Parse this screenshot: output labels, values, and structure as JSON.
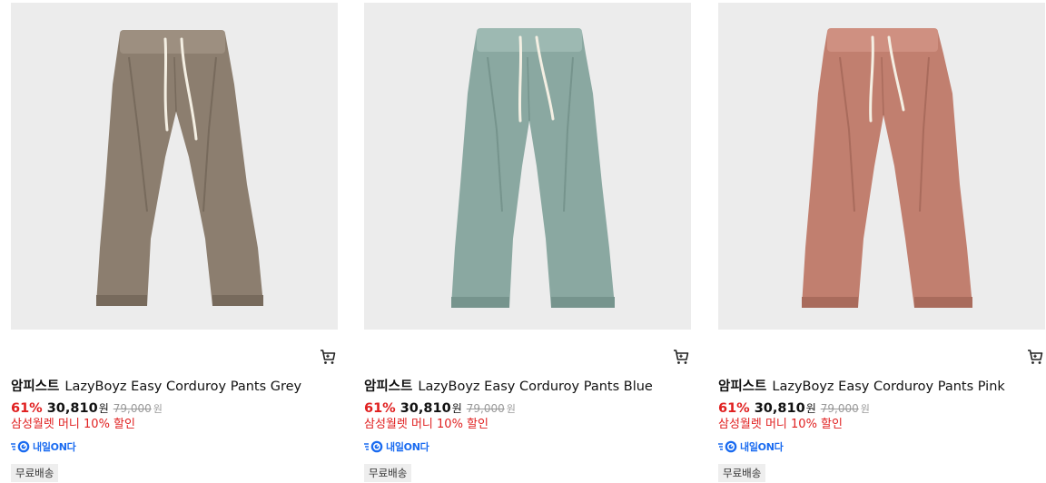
{
  "products": [
    {
      "brand": "암피스트",
      "name": "LazyBoyz Easy Corduroy Pants Grey",
      "discount": "61%",
      "price": "30,810",
      "currency": "원",
      "original_price": "79,000",
      "original_currency": "원",
      "promo": "삼성월렛 머니 10% 할인",
      "delivery_label": "내일ON다",
      "shipping_badge": "무료배송",
      "color": "#8c7e6f",
      "color_shade": "#776a5c",
      "color_light": "#9d8f80"
    },
    {
      "brand": "암피스트",
      "name": "LazyBoyz Easy Corduroy Pants Blue",
      "discount": "61%",
      "price": "30,810",
      "currency": "원",
      "original_price": "79,000",
      "original_currency": "원",
      "promo": "삼성월렛 머니 10% 할인",
      "delivery_label": "내일ON다",
      "shipping_badge": "무료배송",
      "color": "#8aa8a1",
      "color_shade": "#76948d",
      "color_light": "#9db9b2"
    },
    {
      "brand": "암피스트",
      "name": "LazyBoyz Easy Corduroy Pants Pink",
      "discount": "61%",
      "price": "30,810",
      "currency": "원",
      "original_price": "79,000",
      "original_currency": "원",
      "promo": "삼성월렛 머니 10% 할인",
      "delivery_label": "내일ON다",
      "shipping_badge": "무료배송",
      "color": "#c17f6f",
      "color_shade": "#a96b5c",
      "color_light": "#cf9081"
    }
  ],
  "colors": {
    "accent_red": "#e02020",
    "delivery_blue": "#1a6bf0",
    "image_bg": "#ececec"
  },
  "icons": {
    "cart": "cart-icon",
    "delivery": "delivery-truck-icon"
  }
}
